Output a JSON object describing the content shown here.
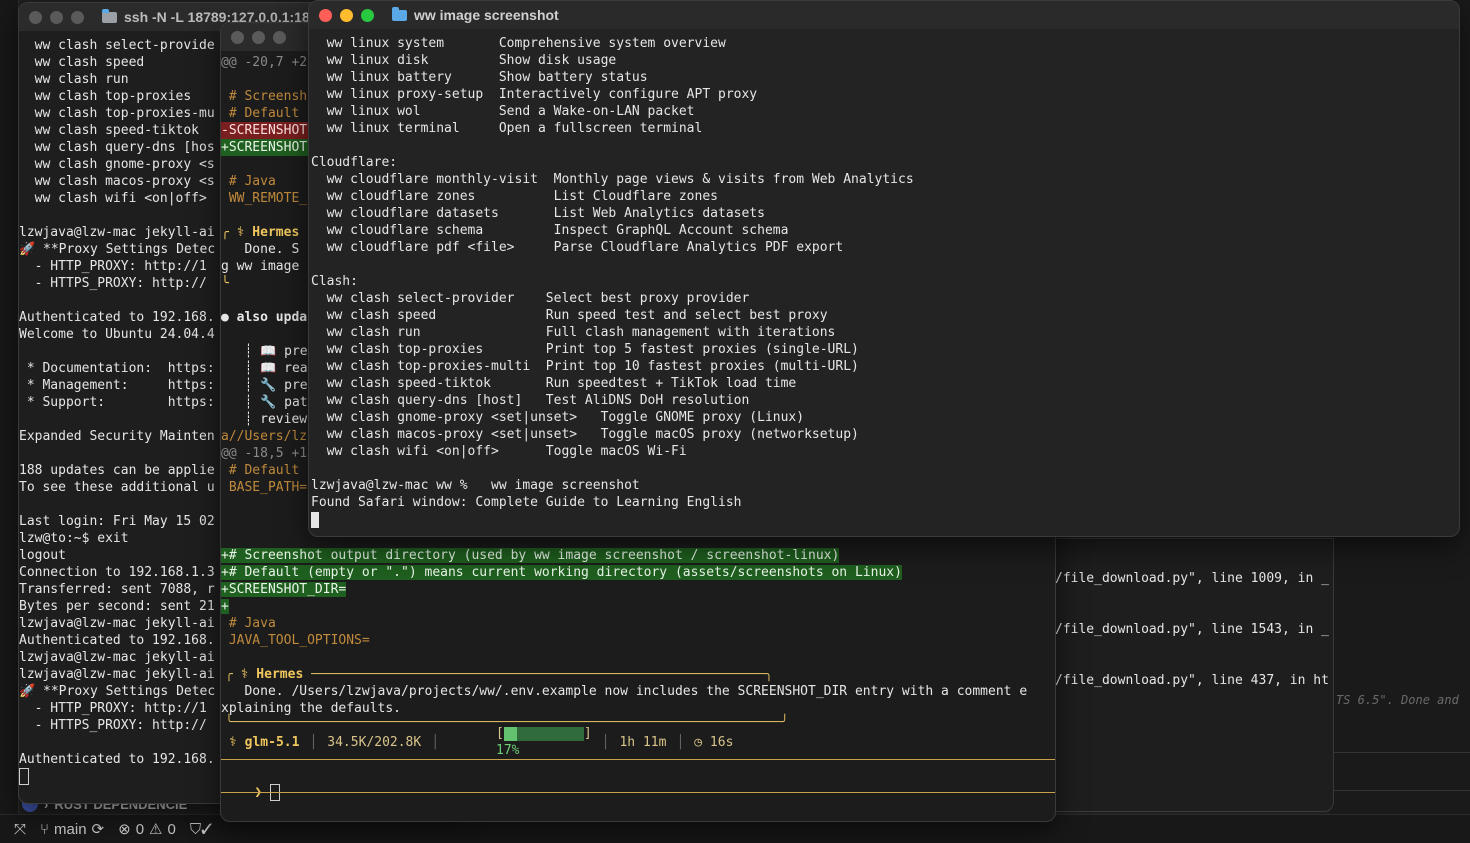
{
  "ssh_window": {
    "title": "ssh -N -L 18789:127.0.0.1:187",
    "lines": [
      "  ww clash select-provide",
      "  ww clash speed",
      "  ww clash run",
      "  ww clash top-proxies",
      "  ww clash top-proxies-mu",
      "  ww clash speed-tiktok",
      "  ww clash query-dns [hos",
      "  ww clash gnome-proxy <s",
      "  ww clash macos-proxy <s",
      "  ww clash wifi <on|off>",
      "",
      "lzwjava@lzw-mac jekyll-ai",
      "🚀 **Proxy Settings Detec",
      "  - HTTP_PROXY: http://1",
      "  - HTTPS_PROXY: http://",
      "",
      "Authenticated to 192.168.",
      "Welcome to Ubuntu 24.04.4",
      "",
      " * Documentation:  https:",
      " * Management:     https:",
      " * Support:        https:",
      "",
      "Expanded Security Mainten",
      "",
      "188 updates can be applie",
      "To see these additional u",
      "",
      "Last login: Fri May 15 02",
      "lzw@to:~$ exit",
      "logout",
      "Connection to 192.168.1.3",
      "Transferred: sent 7088, r",
      "Bytes per second: sent 21",
      "lzwjava@lzw-mac jekyll-ai",
      "Authenticated to 192.168.",
      "lzwjava@lzw-mac jekyll-ai",
      "lzwjava@lzw-mac jekyll-ai",
      "🚀 **Proxy Settings Detec",
      "  - HTTP_PROXY: http://1",
      "  - HTTPS_PROXY: http://",
      "",
      "Authenticated to 192.168."
    ]
  },
  "hermes_window": {
    "title": "",
    "top_lines": [
      {
        "text": "@@ -20,7 +2",
        "style": "hunk"
      },
      {
        "text": "",
        "style": ""
      },
      {
        "text": " # Screensh",
        "style": "comment"
      },
      {
        "text": " # Default",
        "style": "comment"
      },
      {
        "text": "-SCREENSHOT",
        "style": "del"
      },
      {
        "text": "+SCREENSHOT",
        "style": "add"
      },
      {
        "text": "",
        "style": ""
      },
      {
        "text": " # Java",
        "style": "comment"
      },
      {
        "text": " WW_REMOTE_",
        "style": "comment"
      },
      {
        "text": "",
        "style": ""
      },
      {
        "text": "╭ ⚕ Hermes",
        "style": "hermes"
      },
      {
        "text": "   Done. S",
        "style": ""
      },
      {
        "text": "g ww image",
        "style": ""
      },
      {
        "text": "╰",
        "style": "hermes"
      },
      {
        "text": "",
        "style": ""
      },
      {
        "text": "● also upda",
        "style": "bold"
      },
      {
        "text": "",
        "style": ""
      },
      {
        "text": "   ┊ 📖 prep",
        "style": ""
      },
      {
        "text": "   ┊ 📖 read",
        "style": ""
      },
      {
        "text": "   ┊ 🔧 prep",
        "style": ""
      },
      {
        "text": "   ┊ 🔧 patc",
        "style": ""
      },
      {
        "text": "   ┊ review",
        "style": ""
      },
      {
        "text": "a//Users/lz",
        "style": "comment"
      },
      {
        "text": "@@ -18,5 +1",
        "style": "hunk"
      },
      {
        "text": " # Default",
        "style": "comment"
      },
      {
        "text": " BASE_PATH=",
        "style": "comment"
      }
    ],
    "diff_lines": [
      {
        "text": "+# Screenshot output directory (used by ww image screenshot / screenshot-linux)",
        "style": "add"
      },
      {
        "text": "+# Default (empty or \".\") means current working directory (assets/screenshots on Linux)",
        "style": "add"
      },
      {
        "text": "+SCREENSHOT_DIR=",
        "style": "add"
      },
      {
        "text": "+",
        "style": "add"
      },
      {
        "text": " # Java",
        "style": "comment"
      },
      {
        "text": " JAVA_TOOL_OPTIONS=",
        "style": "comment"
      }
    ],
    "hermes_box_title": "⚕ Hermes",
    "hermes_done": "   Done. /Users/lzwjava/projects/ww/.env.example now includes the SCREENSHOT_DIR entry with a comment e",
    "hermes_done_2": "xplaining the defaults.",
    "status": {
      "model": "⚕ glm-5.1",
      "tokens": "34.5K/202.8K",
      "progress_percent": 17,
      "progress_label": "17%",
      "bracket_open": "[",
      "bracket_close": "]",
      "elapsed": "1h 11m",
      "timer": "◷ 16s"
    },
    "prompt_symbol": "❯"
  },
  "log_window": {
    "lines": [
      "/file_download.py\", line 1009, in _",
      "/file_download.py\", line 1543, in _",
      "/file_download.py\", line 437, in ht"
    ]
  },
  "right_panel": {
    "hint": "TS 6.5\". Done and"
  },
  "front_window": {
    "title": "ww image screenshot",
    "lines": [
      "  ww linux system       Comprehensive system overview",
      "  ww linux disk         Show disk usage",
      "  ww linux battery      Show battery status",
      "  ww linux proxy-setup  Interactively configure APT proxy",
      "  ww linux wol          Send a Wake-on-LAN packet",
      "  ww linux terminal     Open a fullscreen terminal",
      "",
      "Cloudflare:",
      "  ww cloudflare monthly-visit  Monthly page views & visits from Web Analytics",
      "  ww cloudflare zones          List Cloudflare zones",
      "  ww cloudflare datasets       List Web Analytics datasets",
      "  ww cloudflare schema         Inspect GraphQL Account schema",
      "  ww cloudflare pdf <file>     Parse Cloudflare Analytics PDF export",
      "",
      "Clash:",
      "  ww clash select-provider    Select best proxy provider",
      "  ww clash speed              Run speed test and select best proxy",
      "  ww clash run                Full clash management with iterations",
      "  ww clash top-proxies        Print top 5 fastest proxies (single-URL)",
      "  ww clash top-proxies-multi  Print top 10 fastest proxies (multi-URL)",
      "  ww clash speed-tiktok       Run speedtest + TikTok load time",
      "  ww clash query-dns [host]   Test AliDNS DoH resolution",
      "  ww clash gnome-proxy <set|unset>   Toggle GNOME proxy (Linux)",
      "  ww clash macos-proxy <set|unset>   Toggle macOS proxy (networksetup)",
      "  ww clash wifi <on|off>      Toggle macOS Wi-Fi",
      "",
      "lzwjava@lzw-mac ww %   ww image screenshot",
      "Found Safari window: Complete Guide to Learning English"
    ]
  },
  "vscode_status": {
    "branch": "main",
    "errors": "0",
    "warnings": "0",
    "rust_deps": "RUST DEPENDENCIE"
  }
}
